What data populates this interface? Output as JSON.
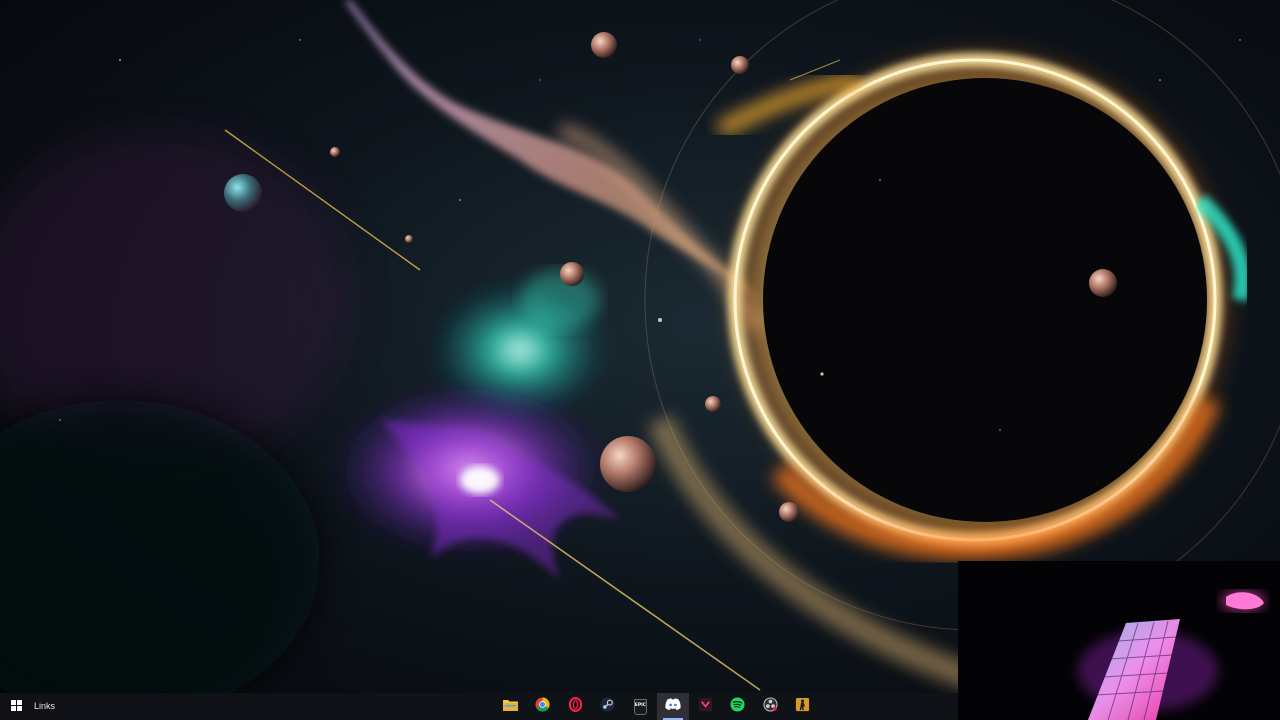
{
  "desktop": {
    "wallpaper": "space-black-hole-wallpaper",
    "accent_colors": {
      "ring": "#ffb22e",
      "nebula_cyan": "#2ef0d0",
      "nebula_violet": "#b13cf0"
    }
  },
  "taskbar": {
    "start_icon": "windows-icon",
    "toolbar_label": "Links",
    "pinned_apps": [
      {
        "id": "file-explorer",
        "icon": "folder-icon",
        "active": false
      },
      {
        "id": "chrome",
        "icon": "chrome-icon",
        "active": false
      },
      {
        "id": "opera-gx",
        "icon": "opera-gx-icon",
        "active": false
      },
      {
        "id": "steam",
        "icon": "steam-icon",
        "active": false
      },
      {
        "id": "epic-games",
        "icon": "epic-games-icon",
        "label": "EPIC",
        "active": false
      },
      {
        "id": "discord",
        "icon": "discord-icon",
        "active": true
      },
      {
        "id": "medal",
        "icon": "medal-icon",
        "active": false
      },
      {
        "id": "spotify",
        "icon": "spotify-icon",
        "active": false
      },
      {
        "id": "obs",
        "icon": "obs-icon",
        "active": false
      },
      {
        "id": "counter-strike",
        "icon": "counter-strike-icon",
        "active": false
      }
    ]
  },
  "webcam_overlay": {
    "content": "rgb-keyboard-and-mouse-camera"
  }
}
